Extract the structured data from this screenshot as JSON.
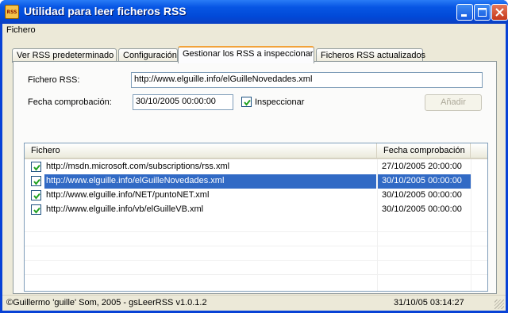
{
  "window": {
    "title": "Utilidad para leer ficheros RSS",
    "icon_text": "RSS"
  },
  "menu": {
    "items": [
      {
        "label": "Fichero"
      }
    ]
  },
  "tabs": [
    {
      "label": "Ver RSS predeterminado"
    },
    {
      "label": "Configuración"
    },
    {
      "label": "Gestionar los RSS a inspeccionar",
      "active": true
    },
    {
      "label": "Ficheros RSS actualizados"
    }
  ],
  "form": {
    "fichero_label": "Fichero RSS:",
    "fichero_value": "http://www.elguille.info/elGuilleNovedades.xml",
    "fecha_label": "Fecha comprobación:",
    "fecha_value": "30/10/2005 00:00:00",
    "inspeccionar_label": "Inspeccionar",
    "inspeccionar_checked": true,
    "add_button": "Añadir"
  },
  "list": {
    "columns": [
      "Fichero",
      "Fecha comprobación"
    ],
    "rows": [
      {
        "checked": true,
        "fichero": "http://msdn.microsoft.com/subscriptions/rss.xml",
        "fecha": "27/10/2005 20:00:00",
        "selected": false
      },
      {
        "checked": true,
        "fichero": "http://www.elguille.info/elGuilleNovedades.xml",
        "fecha": "30/10/2005 00:00:00",
        "selected": true
      },
      {
        "checked": true,
        "fichero": "http://www.elguille.info/NET/puntoNET.xml",
        "fecha": "30/10/2005 00:00:00",
        "selected": false
      },
      {
        "checked": true,
        "fichero": "http://www.elguille.info/vb/elGuilleVB.xml",
        "fecha": "30/10/2005 00:00:00",
        "selected": false
      }
    ]
  },
  "status": {
    "left": "©Guillermo 'guille' Som, 2005 - gsLeerRSS v1.0.1.2",
    "right": "31/10/05 03:14:27"
  },
  "colors": {
    "selection": "#316ac5",
    "title_bar": "#0149d8",
    "tab_highlight": "#f2a23a"
  }
}
